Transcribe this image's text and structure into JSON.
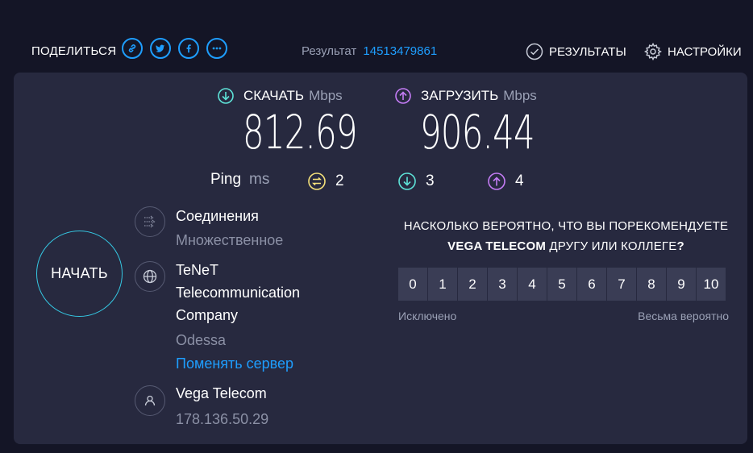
{
  "header": {
    "share_label": "ПОДЕЛИТЬСЯ",
    "share_icons": [
      "link-icon",
      "twitter-icon",
      "facebook-icon",
      "more-icon"
    ],
    "result_label": "Результат",
    "result_id": "14513479861",
    "results_label": "РЕЗУЛЬТАТЫ",
    "settings_label": "НАСТРОЙКИ"
  },
  "download": {
    "label": "СКАЧАТЬ",
    "unit": "Mbps",
    "value": "812.69",
    "color": "#5ee3d8"
  },
  "upload": {
    "label": "ЗАГРУЗИТЬ",
    "unit": "Mbps",
    "value": "906.44",
    "color": "#c47cf5"
  },
  "ping": {
    "label": "Ping",
    "unit": "ms",
    "idle": "2",
    "download": "3",
    "upload": "4",
    "idle_color": "#f5e17a"
  },
  "start_label": "НАЧАТЬ",
  "connections": {
    "title": "Соединения",
    "value": "Множественное"
  },
  "server": {
    "line1": "TeNeT",
    "line2": "Telecommunication",
    "line3": "Company",
    "city": "Odessa",
    "change_label": "Поменять сервер"
  },
  "isp": {
    "name": "Vega Telecom",
    "ip": "178.136.50.29"
  },
  "survey": {
    "question_line1": "НАСКОЛЬКО ВЕРОЯТНО, ЧТО ВЫ ПОРЕКОМЕНДУЕТЕ",
    "brand": "VEGA TELECOM",
    "question_line2_rest": " ДРУГУ ИЛИ КОЛЛЕГЕ",
    "question_mark": "?",
    "scale": [
      "0",
      "1",
      "2",
      "3",
      "4",
      "5",
      "6",
      "7",
      "8",
      "9",
      "10"
    ],
    "low_label": "Исключено",
    "high_label": "Весьма вероятно"
  },
  "colors": {
    "accent": "#1e9eff",
    "background": "#141526",
    "panel": "#27293f"
  }
}
